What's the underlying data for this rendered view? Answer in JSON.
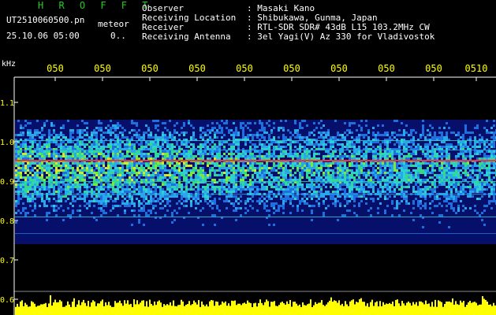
{
  "header": {
    "title": "H R O F F T",
    "filename": "UT2510060500.pn",
    "meteor_label": "meteor",
    "datetime": "25.10.06 05:00",
    "count": "0.."
  },
  "info": [
    {
      "label": "Observer",
      "value": ": Masaki Kano"
    },
    {
      "label": "Receiving Location",
      "value": ": Shibukawa, Gunma, Japan"
    },
    {
      "label": "Receiver",
      "value": ": RTL-SDR SDR# 43dB L15 103.2MHz CW"
    },
    {
      "label": "Receiving Antenna",
      "value": ": 3el Yagi(V) Az 330 for Vladivostok"
    }
  ],
  "axis": {
    "unit": "kHz",
    "y_ticks": [
      "1.1",
      "1.0",
      "0.9",
      "0.8",
      "0.7",
      "0.6"
    ],
    "x_ticks": [
      "050",
      "050",
      "050",
      "050",
      "050",
      "050",
      "050",
      "050",
      "050",
      "0510"
    ]
  },
  "colors": {
    "axis": "#ffffff",
    "tick_text": "#ffff00",
    "title": "#22cc22",
    "carrier": "#ff3030",
    "amplitude": "#ffff00"
  }
}
